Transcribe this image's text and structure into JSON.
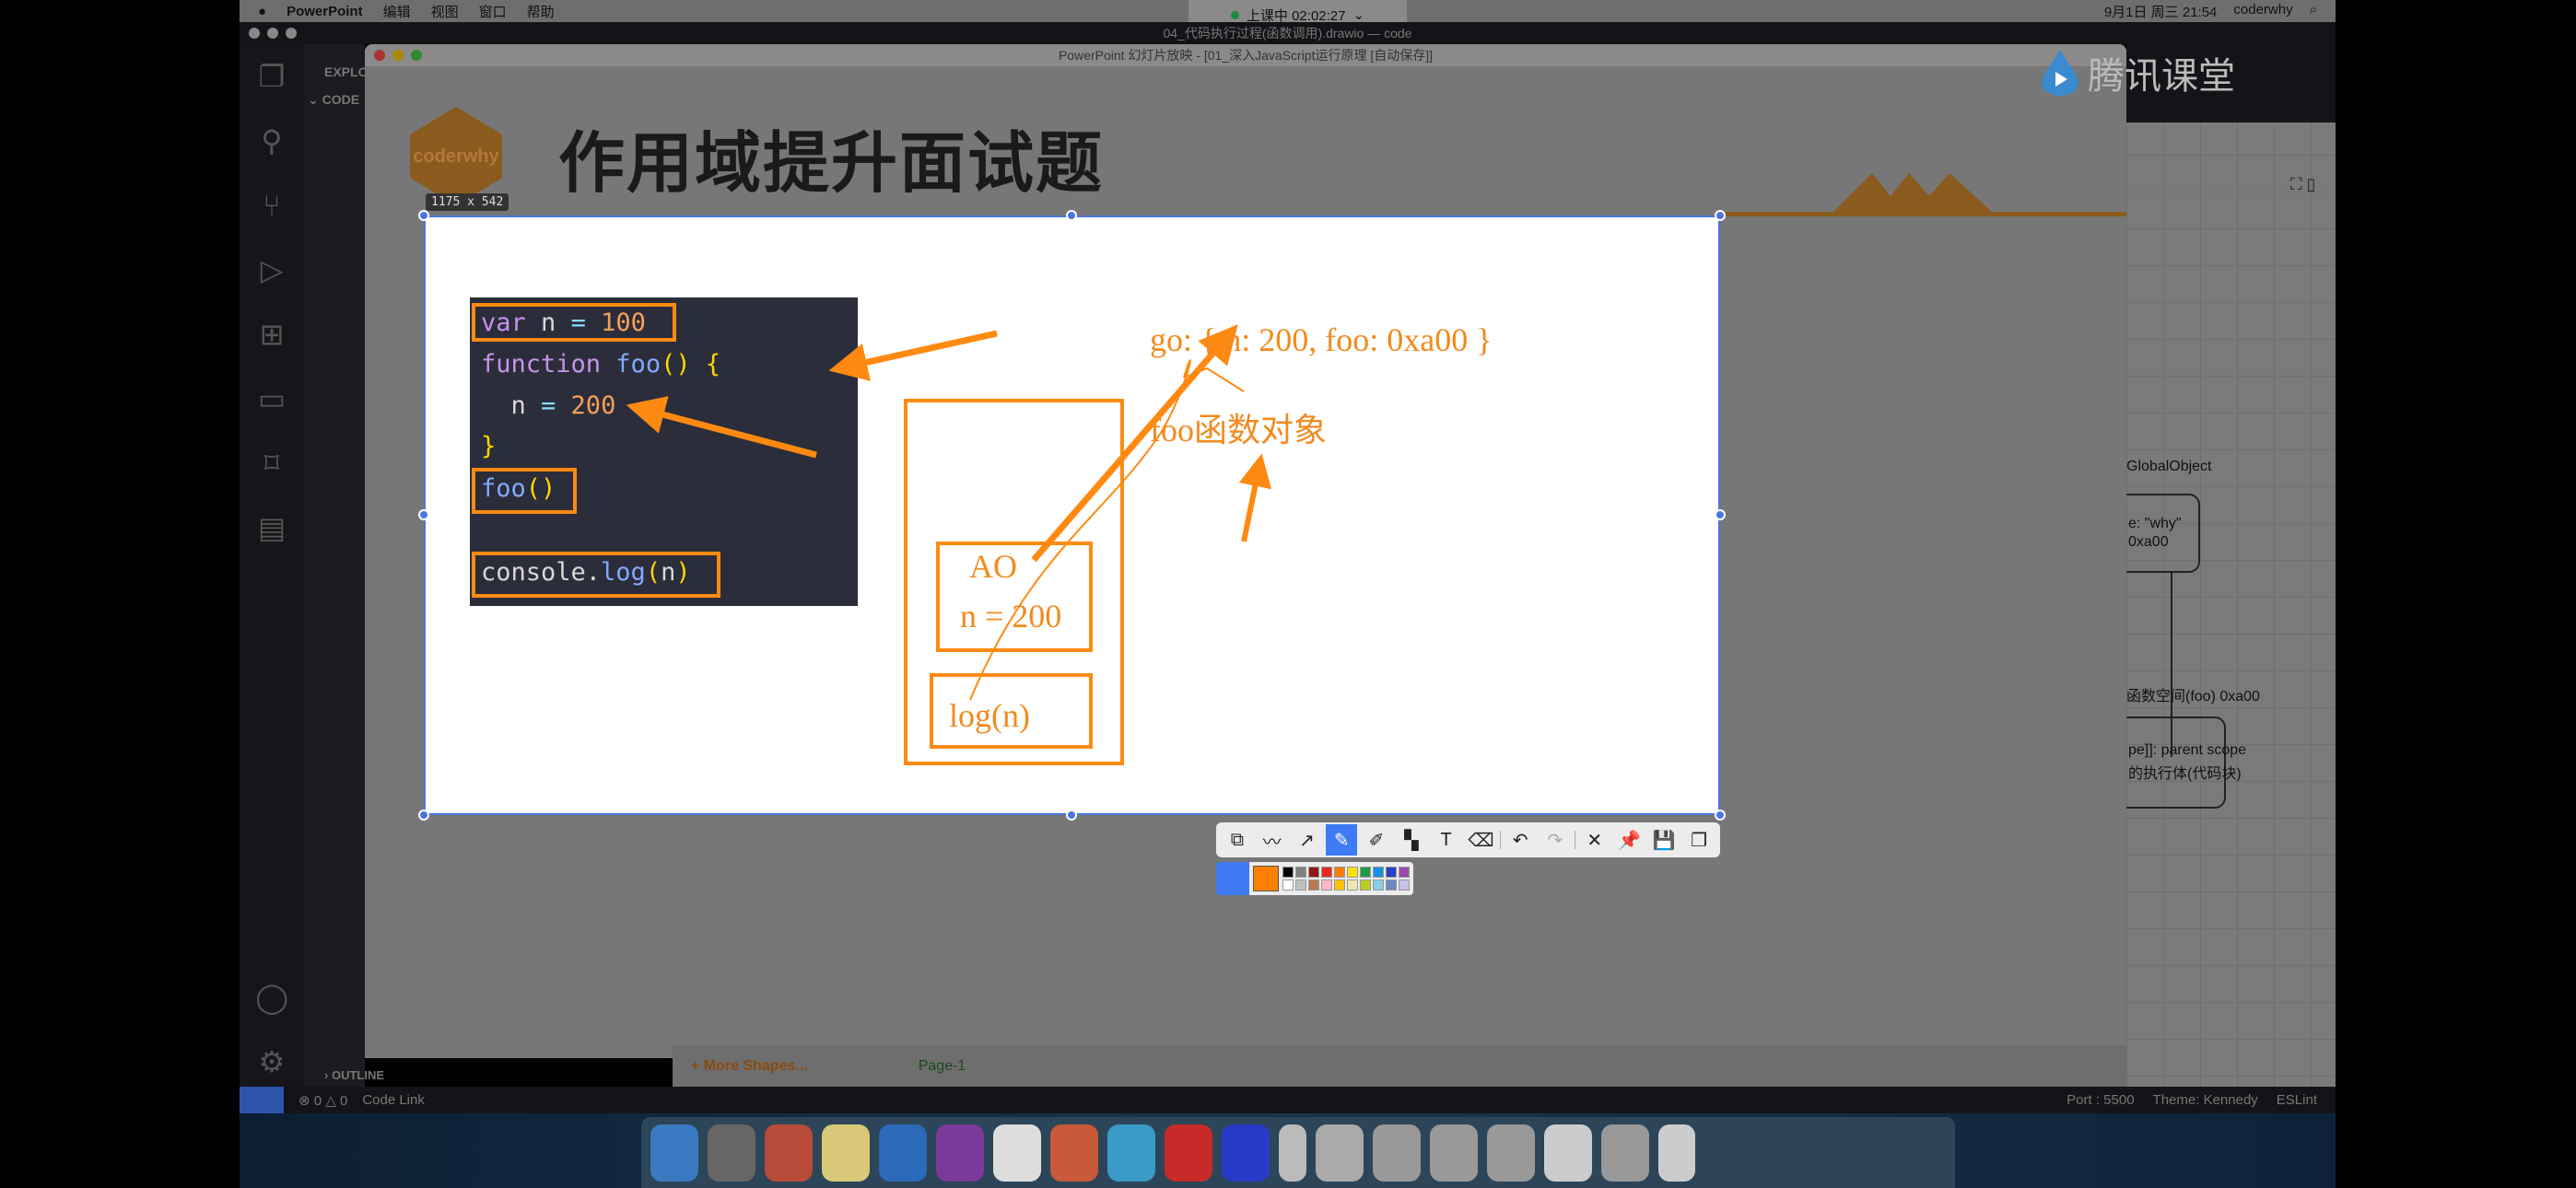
{
  "menubar": {
    "app": "PowerPoint",
    "items": [
      "编辑",
      "视图",
      "窗口",
      "帮助"
    ],
    "datetime": "9月1日 周三 21:54",
    "user": "coderwhy"
  },
  "timer": {
    "label": "上课中 02:02:27"
  },
  "vscode": {
    "title": "04_代码执行过程(函数调用).drawio — code",
    "explorer": "EXPLORER",
    "folder": "CODE",
    "outline": "OUTLINE",
    "status": {
      "errors": "0",
      "warnings": "0",
      "code_link": "Code Link",
      "port": "Port : 5500",
      "theme": "Theme: Kennedy",
      "eslint": "ESLint"
    }
  },
  "ppt": {
    "title": "PowerPoint 幻灯片放映 - [01_深入JavaScript运行原理 [自动保存]]",
    "logo": "coderwhy",
    "slide_title": "作用域提升面试题"
  },
  "selection": {
    "size": "1175 x 542"
  },
  "code": {
    "lines": [
      [
        [
          "kw",
          "var"
        ],
        [
          "pl",
          " n "
        ],
        [
          "op",
          "="
        ],
        [
          "num",
          " 100"
        ]
      ],
      [
        [
          "kw",
          "function"
        ],
        [
          "fn",
          " foo"
        ],
        [
          "br",
          "()"
        ],
        [
          "br",
          " {"
        ]
      ],
      [
        [
          "pl",
          "  n "
        ],
        [
          "op",
          "="
        ],
        [
          "num",
          " 200"
        ]
      ],
      [
        [
          "br",
          "}"
        ]
      ],
      [
        [
          "fn",
          "foo"
        ],
        [
          "br",
          "()"
        ]
      ],
      [
        [
          "pl",
          ""
        ]
      ],
      [
        [
          "pl",
          "console."
        ],
        [
          "fn",
          "log"
        ],
        [
          "br",
          "("
        ],
        [
          "pl",
          "n"
        ],
        [
          "br",
          ")"
        ]
      ]
    ]
  },
  "annotations": {
    "go": "go: { n: 200, foo: 0xa00 }",
    "foo_obj": "foo函数对象",
    "ao": "AO",
    "ao_n": "n = 200",
    "log": "log(n)"
  },
  "toolbar": {
    "tools": [
      "rectangle-icon",
      "polyline-icon",
      "arrow-icon",
      "pen-icon",
      "highlighter-icon",
      "mosaic-icon",
      "text-icon",
      "eraser-icon",
      "undo-icon",
      "redo-icon",
      "close-icon",
      "pin-icon",
      "save-icon",
      "copy-icon"
    ],
    "active": "pen-icon",
    "selected_color": "#ff8000",
    "palette": [
      "#000000",
      "#808080",
      "#8b1a1a",
      "#e8271e",
      "#ff8000",
      "#ffe100",
      "#1e9a4a",
      "#1a8fe0",
      "#2a3fc8",
      "#9a4aa8",
      "#ffffff",
      "#c0c0c0",
      "#b87a50",
      "#ffb6c8",
      "#ffc400",
      "#eee8b0",
      "#b8d020",
      "#8ad0e8",
      "#6a8ac8",
      "#c8c0e8"
    ]
  },
  "drawio": {
    "brand": "腾讯课堂",
    "global": "GlobalObject",
    "box1": [
      "e: \"why\"",
      "0xa00"
    ],
    "label2": "函数空间(foo) 0xa00",
    "box2": [
      "pe]]: parent scope",
      "的执行体(代码块)"
    ],
    "more_shapes": "+ More Shapes...",
    "page": "Page-1"
  },
  "colors": {
    "accent": "#f28a1e",
    "selection": "#4a76e0"
  }
}
